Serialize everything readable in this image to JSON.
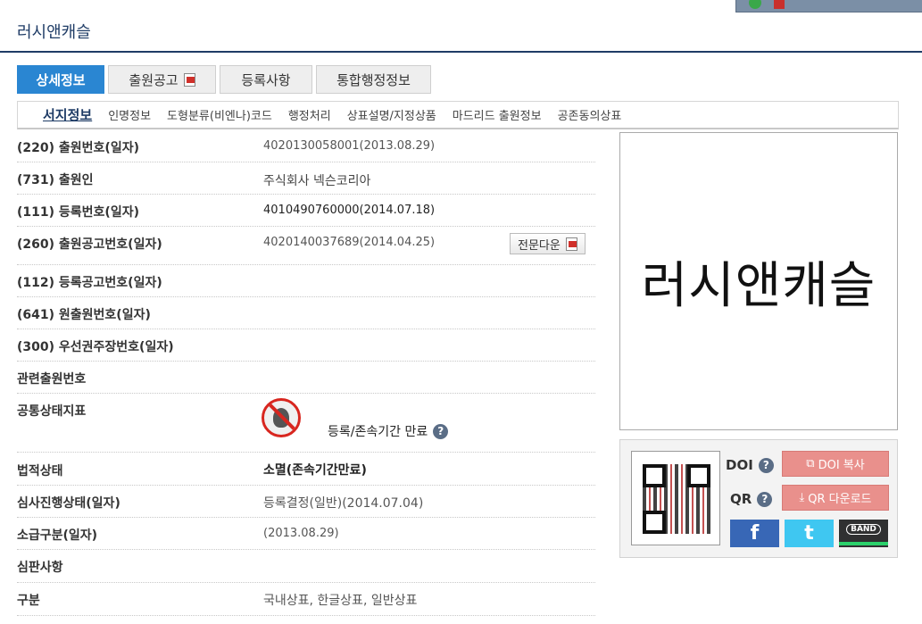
{
  "title": "러시앤캐슬",
  "tabs": [
    {
      "label": "상세정보",
      "active": true
    },
    {
      "label": "출원공고",
      "pdf": true
    },
    {
      "label": "등록사항"
    },
    {
      "label": "통합행정정보"
    }
  ],
  "subnav": [
    "서지정보",
    "인명정보",
    "도형분류(비엔나)코드",
    "행정처리",
    "상표설명/지정상품",
    "마드리드 출원정보",
    "공존동의상표"
  ],
  "rows": [
    {
      "label": "(220) 출원번호(일자)",
      "value": "4020130058001(2013.08.29)"
    },
    {
      "label": "(731) 출원인",
      "value": "주식회사 넥슨코리아"
    },
    {
      "label": "(111) 등록번호(일자)",
      "value": "4010490760000(2014.07.18)"
    },
    {
      "label": "(260) 출원공고번호(일자)",
      "value": "4020140037689(2014.04.25)",
      "button": "전문다운"
    },
    {
      "label": "(112) 등록공고번호(일자)",
      "value": ""
    },
    {
      "label": "(641) 원출원번호(일자)",
      "value": ""
    },
    {
      "label": "(300) 우선권주장번호(일자)",
      "value": ""
    },
    {
      "label": "관련출원번호",
      "value": ""
    },
    {
      "label": "공통상태지표",
      "value": "등록/존속기간 만료"
    },
    {
      "label": "법적상태",
      "value": "소멸(존속기간만료)"
    },
    {
      "label": "심사진행상태(일자)",
      "value": "등록결정(일반)(2014.07.04)"
    },
    {
      "label": "소급구분(일자)",
      "value": "(2013.08.29)"
    },
    {
      "label": "심판사항",
      "value": ""
    },
    {
      "label": "구분",
      "value": "국내상표, 한글상표, 일반상표"
    }
  ],
  "trademark_text": "러시앤캐슬",
  "share": {
    "doi_label": "DOI",
    "qr_label": "QR",
    "doi_button": "DOI 복사",
    "qr_button": "QR 다운로드",
    "facebook": "f",
    "twitter": "t",
    "band": "BAND"
  },
  "colors": {
    "accent": "#2a86d2",
    "title": "#1f3c66",
    "share_button": "#e9908c"
  }
}
